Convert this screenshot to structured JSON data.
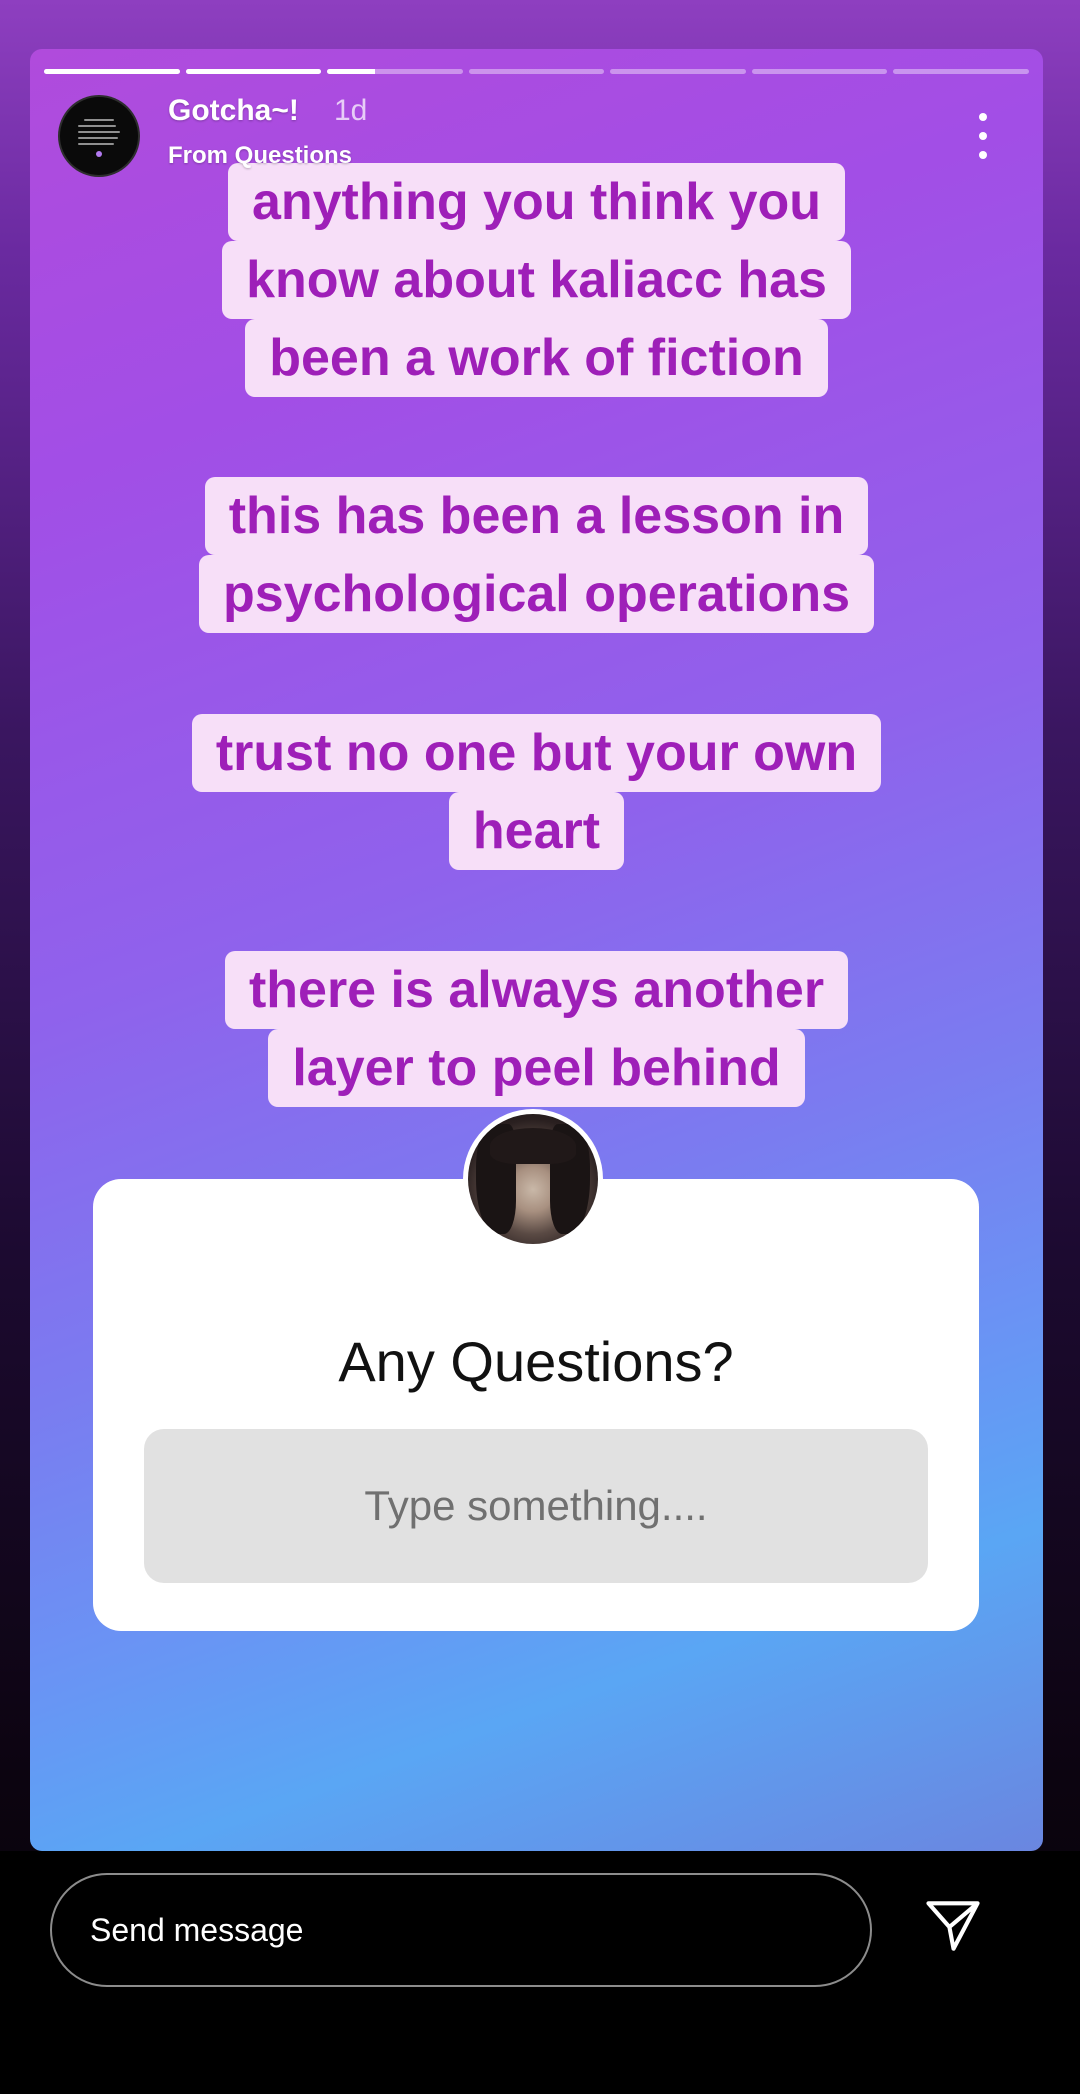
{
  "story": {
    "progress": [
      1,
      1,
      0.35,
      0,
      0,
      0,
      0
    ],
    "user": {
      "name": "Gotcha~!",
      "time": "1d",
      "source": "From Questions"
    },
    "text_blocks": [
      {
        "lines": [
          "anything you think you",
          "know about kaliacc has",
          "been a work of fiction"
        ]
      },
      {
        "lines": [
          "this has been a lesson in",
          "psychological operations"
        ]
      },
      {
        "lines": [
          "trust no one but your own",
          "heart"
        ]
      },
      {
        "lines": [
          "there is always another",
          "layer to peel behind"
        ]
      }
    ],
    "question_sticker": {
      "title": "Any Questions?",
      "placeholder": "Type something...."
    }
  },
  "reply": {
    "placeholder": "Send message"
  },
  "icons": {
    "more": "more-vertical-icon",
    "send": "paper-plane-icon"
  },
  "colors": {
    "text_chip_bg": "#f7dff8",
    "text_chip_fg": "#9e1fb8"
  }
}
